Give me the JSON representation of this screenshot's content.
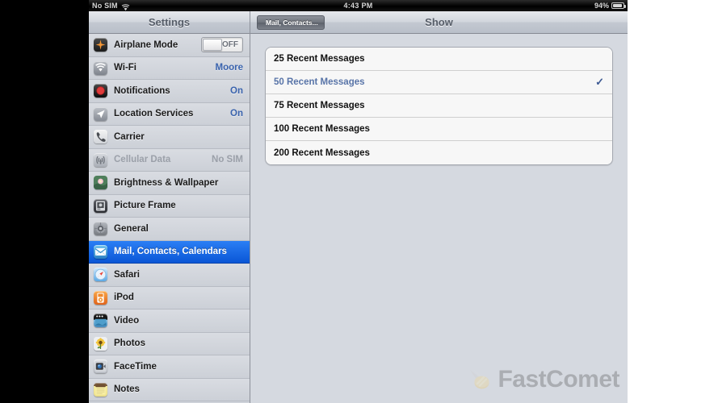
{
  "status_bar": {
    "carrier": "No SIM",
    "wifi_icon": "wifi-icon",
    "time": "4:43 PM",
    "battery_percent": "94%",
    "battery_icon": "battery-icon"
  },
  "sidebar": {
    "title": "Settings",
    "items": [
      {
        "label": "Airplane Mode",
        "icon": "airplane-icon",
        "icon_class": "g-plane",
        "control": "toggle",
        "toggle_label": "OFF",
        "value": "",
        "state": "normal"
      },
      {
        "label": "Wi-Fi",
        "icon": "wifi-icon",
        "icon_class": "g-wifi",
        "control": "value",
        "value": "Moore",
        "state": "normal"
      },
      {
        "label": "Notifications",
        "icon": "notifications-icon",
        "icon_class": "g-notif",
        "control": "value",
        "value": "On",
        "state": "normal"
      },
      {
        "label": "Location Services",
        "icon": "location-icon",
        "icon_class": "g-loc",
        "control": "value",
        "value": "On",
        "state": "normal"
      },
      {
        "label": "Carrier",
        "icon": "carrier-icon",
        "icon_class": "g-carrier",
        "control": "value",
        "value": "",
        "state": "normal"
      },
      {
        "label": "Cellular Data",
        "icon": "cellular-icon",
        "icon_class": "g-cell",
        "control": "value",
        "value": "No SIM",
        "state": "disabled"
      },
      {
        "label": "Brightness & Wallpaper",
        "icon": "brightness-icon",
        "icon_class": "g-bright",
        "control": "value",
        "value": "",
        "state": "normal"
      },
      {
        "label": "Picture Frame",
        "icon": "picture-frame-icon",
        "icon_class": "g-frame",
        "control": "value",
        "value": "",
        "state": "normal"
      },
      {
        "label": "General",
        "icon": "general-gear-icon",
        "icon_class": "g-general",
        "control": "value",
        "value": "",
        "state": "normal"
      },
      {
        "label": "Mail, Contacts, Calendars",
        "icon": "mail-icon",
        "icon_class": "g-mail",
        "control": "value",
        "value": "",
        "state": "selected"
      },
      {
        "label": "Safari",
        "icon": "safari-compass-icon",
        "icon_class": "g-safari",
        "control": "value",
        "value": "",
        "state": "normal"
      },
      {
        "label": "iPod",
        "icon": "ipod-icon",
        "icon_class": "g-ipod",
        "control": "value",
        "value": "",
        "state": "normal"
      },
      {
        "label": "Video",
        "icon": "video-clapper-icon",
        "icon_class": "g-video",
        "control": "value",
        "value": "",
        "state": "normal"
      },
      {
        "label": "Photos",
        "icon": "photos-sunflower-icon",
        "icon_class": "g-photos",
        "control": "value",
        "value": "",
        "state": "normal"
      },
      {
        "label": "FaceTime",
        "icon": "facetime-camera-icon",
        "icon_class": "g-face",
        "control": "value",
        "value": "",
        "state": "normal"
      },
      {
        "label": "Notes",
        "icon": "notes-icon",
        "icon_class": "g-notes",
        "control": "value",
        "value": "",
        "state": "normal"
      }
    ]
  },
  "detail": {
    "back_label": "Mail, Contacts...",
    "title": "Show",
    "options": [
      {
        "label": "25 Recent Messages",
        "selected": false
      },
      {
        "label": "50 Recent Messages",
        "selected": true
      },
      {
        "label": "75 Recent Messages",
        "selected": false
      },
      {
        "label": "100 Recent Messages",
        "selected": false
      },
      {
        "label": "200 Recent Messages",
        "selected": false
      }
    ],
    "checkmark": "✓"
  },
  "watermark": {
    "text": "FastComet",
    "icon": "comet-icon"
  },
  "colors": {
    "selection_blue": "#0a56d6",
    "link_blue": "#3a63ad",
    "selected_option_blue": "#5874a8",
    "checkmark_blue": "#3d5a93",
    "sidebar_bg": "#ced2d9",
    "detail_bg": "#d5d9e0"
  }
}
